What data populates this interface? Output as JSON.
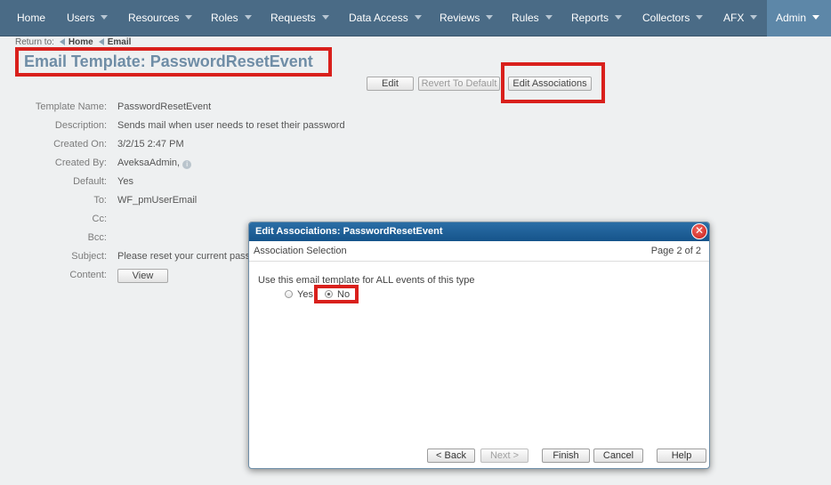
{
  "nav": {
    "items": [
      {
        "label": "Home",
        "caret": false
      },
      {
        "label": "Users",
        "caret": true
      },
      {
        "label": "Resources",
        "caret": true
      },
      {
        "label": "Roles",
        "caret": true
      },
      {
        "label": "Requests",
        "caret": true
      },
      {
        "label": "Data Access",
        "caret": true
      },
      {
        "label": "Reviews",
        "caret": true
      },
      {
        "label": "Rules",
        "caret": true
      },
      {
        "label": "Reports",
        "caret": true
      },
      {
        "label": "Collectors",
        "caret": true
      },
      {
        "label": "AFX",
        "caret": true
      },
      {
        "label": "Admin",
        "caret": true,
        "active": true
      }
    ]
  },
  "breadcrumb": {
    "prefix": "Return to:",
    "home": "Home",
    "email": "Email"
  },
  "page": {
    "title": "Email Template: PasswordResetEvent"
  },
  "actions": {
    "edit": "Edit",
    "revert": "Revert To Default",
    "edit_associations": "Edit Associations"
  },
  "details": {
    "template_name_label": "Template Name:",
    "template_name": "PasswordResetEvent",
    "description_label": "Description:",
    "description": "Sends mail when user needs to reset their password",
    "created_on_label": "Created On:",
    "created_on": "3/2/15 2:47 PM",
    "created_by_label": "Created By:",
    "created_by": "AveksaAdmin,",
    "default_label": "Default:",
    "default": "Yes",
    "to_label": "To:",
    "to": "WF_pmUserEmail",
    "cc_label": "Cc:",
    "cc": "",
    "bcc_label": "Bcc:",
    "bcc": "",
    "subject_label": "Subject:",
    "subject": "Please reset your current pass",
    "content_label": "Content:",
    "view_button": "View"
  },
  "modal": {
    "title": "Edit Associations: PasswordResetEvent",
    "close_glyph": "✕",
    "section": "Association Selection",
    "page": "Page 2 of 2",
    "question": "Use this email template for ALL events of this type",
    "yes_label": "Yes",
    "no_label": "No",
    "selected": "No",
    "buttons": {
      "back": "< Back",
      "next": "Next >",
      "finish": "Finish",
      "cancel": "Cancel",
      "help": "Help"
    }
  },
  "colors": {
    "nav_bg": "#4a6b86",
    "nav_active": "#5d87a8",
    "title": "#6f8da6",
    "highlight": "#d9201c",
    "modal_header": "#1d5e96"
  }
}
